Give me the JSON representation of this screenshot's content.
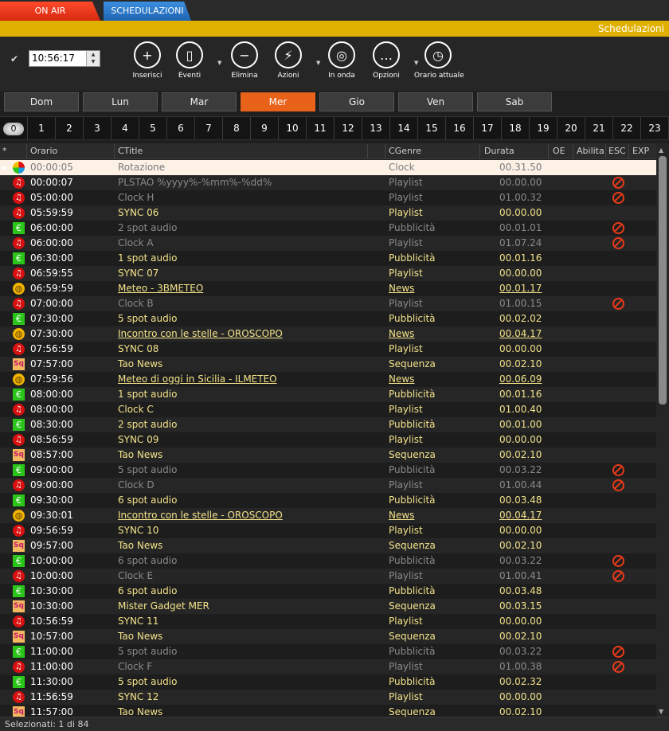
{
  "tabs": {
    "onair": "ON AIR",
    "schedule": "SCHEDULAZIONI"
  },
  "section_title": "Schedulazioni",
  "time_value": "10:56:17",
  "toolbar": [
    {
      "name": "insert-button",
      "icon": "plus-icon",
      "label": "Inserisci",
      "glyph": "+",
      "dropdown": false
    },
    {
      "name": "events-button",
      "icon": "document-icon",
      "label": "Eventi",
      "glyph": "▯",
      "dropdown": true
    },
    {
      "name": "delete-button",
      "icon": "minus-icon",
      "label": "Elimina",
      "glyph": "−",
      "dropdown": false
    },
    {
      "name": "actions-button",
      "icon": "lightning-icon",
      "label": "Azioni",
      "glyph": "⚡",
      "dropdown": true
    },
    {
      "name": "on-air-button",
      "icon": "target-icon",
      "label": "In onda",
      "glyph": "◎",
      "dropdown": false
    },
    {
      "name": "options-button",
      "icon": "dots-icon",
      "label": "Opzioni",
      "glyph": "…",
      "dropdown": true
    },
    {
      "name": "current-time-button",
      "icon": "clock-search-icon",
      "label": "Orario attuale",
      "glyph": "◷",
      "dropdown": false
    }
  ],
  "days": [
    "Dom",
    "Lun",
    "Mar",
    "Mer",
    "Gio",
    "Ven",
    "Sab"
  ],
  "active_day": "Mer",
  "hours": [
    "0",
    "1",
    "2",
    "3",
    "4",
    "5",
    "6",
    "7",
    "8",
    "9",
    "10",
    "11",
    "12",
    "13",
    "14",
    "15",
    "16",
    "17",
    "18",
    "19",
    "20",
    "21",
    "22",
    "23"
  ],
  "active_hour": "0",
  "columns": {
    "star": "*",
    "time": "Orario",
    "title": "CTitle",
    "genre": "CGenre",
    "duration": "Durata",
    "oe": "OE",
    "enabled": "Abilita",
    "esc": "ESC",
    "exp": "EXP"
  },
  "rows": [
    {
      "icon": "rot",
      "time": "00:00:05",
      "title": "Rotazione",
      "genre": "Clock",
      "duration": "00.31.50",
      "style": "sel",
      "esc": false
    },
    {
      "icon": "music",
      "time": "00:00:07",
      "title": "PLSTAO %yyyy%-%mm%-%dd%",
      "genre": "Playlist",
      "duration": "00.00.00",
      "style": "dim",
      "esc": true
    },
    {
      "icon": "music",
      "time": "05:00:00",
      "title": "Clock H",
      "genre": "Playlist",
      "duration": "01.00.32",
      "style": "dim",
      "esc": true
    },
    {
      "icon": "music",
      "time": "05:59:59",
      "title": "SYNC 06",
      "genre": "Playlist",
      "duration": "00.00.00",
      "style": "yel",
      "esc": false
    },
    {
      "icon": "euro",
      "time": "06:00:00",
      "title": "2 spot audio",
      "genre": "Pubblicità",
      "duration": "00.01.01",
      "style": "dim",
      "esc": true
    },
    {
      "icon": "music",
      "time": "06:00:00",
      "title": "Clock A",
      "genre": "Playlist",
      "duration": "01.07.24",
      "style": "dim",
      "esc": true
    },
    {
      "icon": "euro",
      "time": "06:30:00",
      "title": "1 spot audio",
      "genre": "Pubblicità",
      "duration": "00.01.16",
      "style": "yel",
      "esc": false
    },
    {
      "icon": "music",
      "time": "06:59:55",
      "title": "SYNC 07",
      "genre": "Playlist",
      "duration": "00.00.00",
      "style": "yel",
      "esc": false
    },
    {
      "icon": "globe",
      "time": "06:59:59",
      "title": "Meteo - 3BMETEO",
      "genre": "News",
      "duration": "00.01.17",
      "style": "link",
      "esc": false
    },
    {
      "icon": "music",
      "time": "07:00:00",
      "title": "Clock B",
      "genre": "Playlist",
      "duration": "01.00.15",
      "style": "dim",
      "esc": true
    },
    {
      "icon": "euro",
      "time": "07:30:00",
      "title": "5 spot audio",
      "genre": "Pubblicità",
      "duration": "00.02.02",
      "style": "yel",
      "esc": false
    },
    {
      "icon": "globe",
      "time": "07:30:00",
      "title": "Incontro con le stelle - OROSCOPO",
      "genre": "News",
      "duration": "00.04.17",
      "style": "link",
      "esc": false
    },
    {
      "icon": "music",
      "time": "07:56:59",
      "title": "SYNC 08",
      "genre": "Playlist",
      "duration": "00.00.00",
      "style": "yel",
      "esc": false
    },
    {
      "icon": "seq",
      "time": "07:57:00",
      "title": "Tao News",
      "genre": "Sequenza",
      "duration": "00.02.10",
      "style": "yel",
      "esc": false
    },
    {
      "icon": "globe",
      "time": "07:59:56",
      "title": "Meteo di oggi in Sicilia - ILMETEO",
      "genre": "News",
      "duration": "00.06.09",
      "style": "link",
      "esc": false
    },
    {
      "icon": "euro",
      "time": "08:00:00",
      "title": "1 spot audio",
      "genre": "Pubblicità",
      "duration": "00.01.16",
      "style": "yel",
      "esc": false
    },
    {
      "icon": "music",
      "time": "08:00:00",
      "title": "Clock C",
      "genre": "Playlist",
      "duration": "01.00.40",
      "style": "yel",
      "esc": false
    },
    {
      "icon": "euro",
      "time": "08:30:00",
      "title": "2 spot audio",
      "genre": "Pubblicità",
      "duration": "00.01.00",
      "style": "yel",
      "esc": false
    },
    {
      "icon": "music",
      "time": "08:56:59",
      "title": "SYNC 09",
      "genre": "Playlist",
      "duration": "00.00.00",
      "style": "yel",
      "esc": false
    },
    {
      "icon": "seq",
      "time": "08:57:00",
      "title": "Tao News",
      "genre": "Sequenza",
      "duration": "00.02.10",
      "style": "yel",
      "esc": false
    },
    {
      "icon": "euro",
      "time": "09:00:00",
      "title": "5 spot audio",
      "genre": "Pubblicità",
      "duration": "00.03.22",
      "style": "dim",
      "esc": true
    },
    {
      "icon": "music",
      "time": "09:00:00",
      "title": "Clock D",
      "genre": "Playlist",
      "duration": "01.00.44",
      "style": "dim",
      "esc": true
    },
    {
      "icon": "euro",
      "time": "09:30:00",
      "title": "6 spot audio",
      "genre": "Pubblicità",
      "duration": "00.03.48",
      "style": "yel",
      "esc": false
    },
    {
      "icon": "globe",
      "time": "09:30:01",
      "title": "Incontro con le stelle - OROSCOPO",
      "genre": "News",
      "duration": "00.04.17",
      "style": "link",
      "esc": false
    },
    {
      "icon": "music",
      "time": "09:56:59",
      "title": "SYNC 10",
      "genre": "Playlist",
      "duration": "00.00.00",
      "style": "yel",
      "esc": false
    },
    {
      "icon": "seq",
      "time": "09:57:00",
      "title": "Tao News",
      "genre": "Sequenza",
      "duration": "00.02.10",
      "style": "yel",
      "esc": false
    },
    {
      "icon": "euro",
      "time": "10:00:00",
      "title": "6 spot audio",
      "genre": "Pubblicità",
      "duration": "00.03.22",
      "style": "dim",
      "esc": true
    },
    {
      "icon": "music",
      "time": "10:00:00",
      "title": "Clock E",
      "genre": "Playlist",
      "duration": "01.00.41",
      "style": "dim",
      "esc": true
    },
    {
      "icon": "euro",
      "time": "10:30:00",
      "title": "6 spot audio",
      "genre": "Pubblicità",
      "duration": "00.03.48",
      "style": "yel",
      "esc": false
    },
    {
      "icon": "seq",
      "time": "10:30:00",
      "title": "Mister Gadget MER",
      "genre": "Sequenza",
      "duration": "00.03.15",
      "style": "yel",
      "esc": false
    },
    {
      "icon": "music",
      "time": "10:56:59",
      "title": "SYNC 11",
      "genre": "Playlist",
      "duration": "00.00.00",
      "style": "yel",
      "esc": false
    },
    {
      "icon": "seq",
      "time": "10:57:00",
      "title": "Tao News",
      "genre": "Sequenza",
      "duration": "00.02.10",
      "style": "yel",
      "esc": false
    },
    {
      "icon": "euro",
      "time": "11:00:00",
      "title": "5 spot audio",
      "genre": "Pubblicità",
      "duration": "00.03.22",
      "style": "dim",
      "esc": true
    },
    {
      "icon": "music",
      "time": "11:00:00",
      "title": "Clock F",
      "genre": "Playlist",
      "duration": "01.00.38",
      "style": "dim",
      "esc": true
    },
    {
      "icon": "euro",
      "time": "11:30:00",
      "title": "5 spot audio",
      "genre": "Pubblicità",
      "duration": "00.02.32",
      "style": "yel",
      "esc": false
    },
    {
      "icon": "music",
      "time": "11:56:59",
      "title": "SYNC 12",
      "genre": "Playlist",
      "duration": "00.00.00",
      "style": "yel",
      "esc": false
    },
    {
      "icon": "seq",
      "time": "11:57:00",
      "title": "Tao News",
      "genre": "Sequenza",
      "duration": "00.02.10",
      "style": "yel",
      "esc": false
    }
  ],
  "status": "Selezionati: 1 di 84"
}
